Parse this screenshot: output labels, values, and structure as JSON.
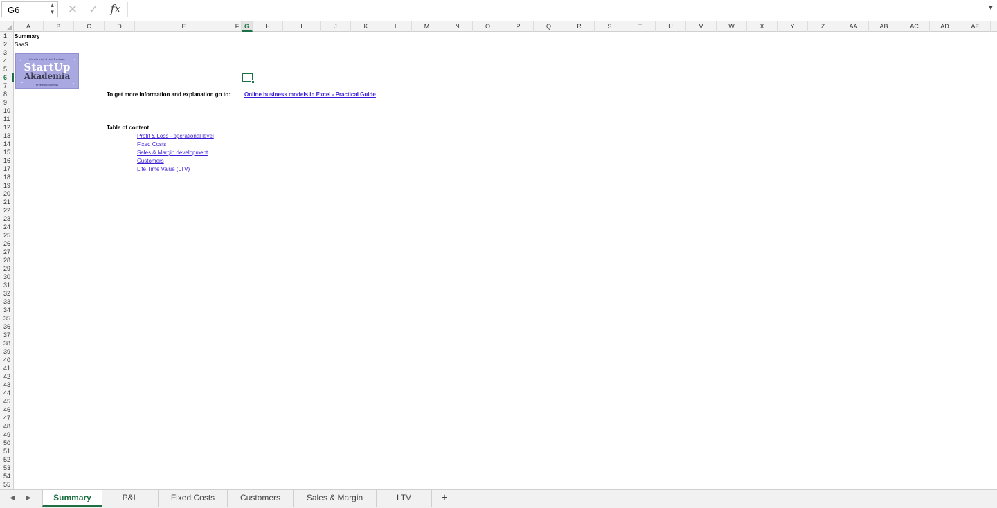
{
  "formula_bar": {
    "name_box": "G6",
    "cancel_glyph": "✕",
    "confirm_glyph": "✓",
    "fx_label": "fx",
    "formula_value": "",
    "expand_glyph": "▼"
  },
  "grid": {
    "columns": [
      "A",
      "B",
      "C",
      "D",
      "E",
      "F",
      "G",
      "H",
      "I",
      "J",
      "K",
      "L",
      "M",
      "N",
      "O",
      "P",
      "Q",
      "R",
      "S",
      "T",
      "U",
      "V",
      "W",
      "X",
      "Y",
      "Z",
      "AA",
      "AB",
      "AC",
      "AD",
      "AE"
    ],
    "active_column": "G",
    "active_row": 6,
    "row_count": 55
  },
  "cells": {
    "a1": "Summary",
    "a2": "SaaS",
    "d8": "To get more information and explanation go to:",
    "g8_link": "Online business models in Excel - Practical Guide",
    "d12": "Table of content",
    "toc": [
      "Profit & Loss - operational level",
      "Fixed Costs",
      "Sales & Margin development",
      "Customers",
      "Life Time Value (LTV)"
    ]
  },
  "logo": {
    "top_line": "Wordsbad Brad Partner",
    "word1": "StartUp",
    "word2": "Akademia",
    "bottom_line": "Przedsiębiorczość",
    "bg_color": "#a9a8e0"
  },
  "sheet_tabs": {
    "prev_glyph": "◀",
    "next_glyph": "▶",
    "tabs": [
      "Summary",
      "P&L",
      "Fixed Costs",
      "Customers",
      "Sales & Margin",
      "LTV"
    ],
    "active": "Summary",
    "add_glyph": "+"
  },
  "colors": {
    "accent": "#1d7044",
    "link": "#3b1dd6"
  }
}
